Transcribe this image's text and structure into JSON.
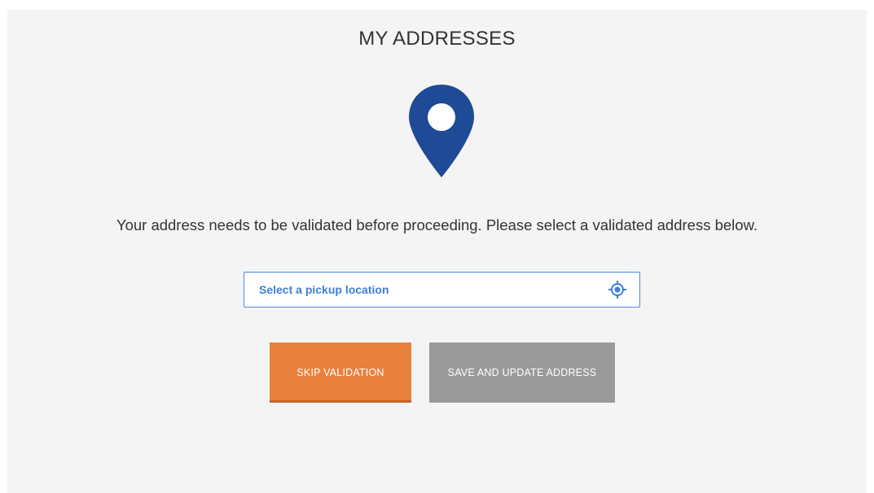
{
  "page": {
    "title": "MY ADDRESSES",
    "message": "Your address needs to be validated before proceeding. Please select a validated address below."
  },
  "pickup": {
    "placeholder": "Select a pickup location"
  },
  "actions": {
    "skip_label": "SKIP VALIDATION",
    "save_label": "SAVE AND UPDATE ADDRESS"
  },
  "colors": {
    "pin": "#1f4a95",
    "skip_button": "#e8813e",
    "save_button": "#9a9a9a",
    "input_border": "#4a86e8"
  },
  "icons": {
    "pin": "map-pin-icon",
    "locate": "locate-target-icon"
  }
}
